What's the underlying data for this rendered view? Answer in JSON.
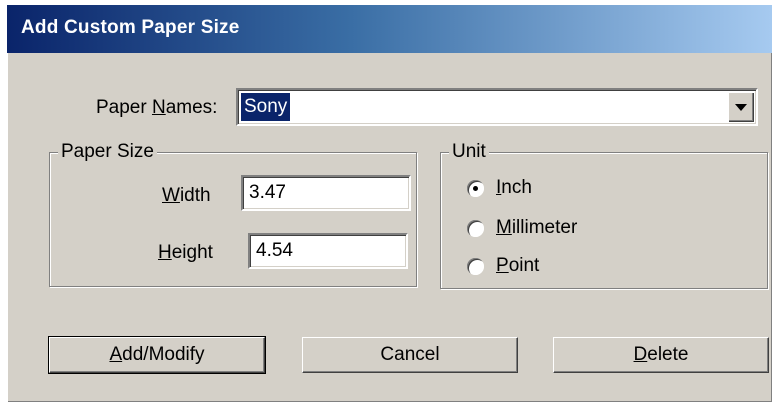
{
  "window": {
    "title": "Add Custom Paper Size"
  },
  "paper_names": {
    "label_prefix": "Paper ",
    "label_accel": "N",
    "label_suffix": "ames:",
    "value": "Sony"
  },
  "paper_size": {
    "group_label": "Paper Size",
    "width_accel": "W",
    "width_rest": "idth",
    "width_value": "3.47",
    "height_accel": "H",
    "height_rest": "eight",
    "height_value": "4.54"
  },
  "unit": {
    "group_label": "Unit",
    "selected": "Inch",
    "options": [
      {
        "accel": "I",
        "rest": "nch"
      },
      {
        "accel": "M",
        "rest": "illimeter"
      },
      {
        "accel": "P",
        "rest": "oint"
      }
    ]
  },
  "buttons": {
    "add_accel": "A",
    "add_rest": "dd/Modify",
    "cancel": "Cancel",
    "delete_accel": "D",
    "delete_rest": "elete"
  }
}
